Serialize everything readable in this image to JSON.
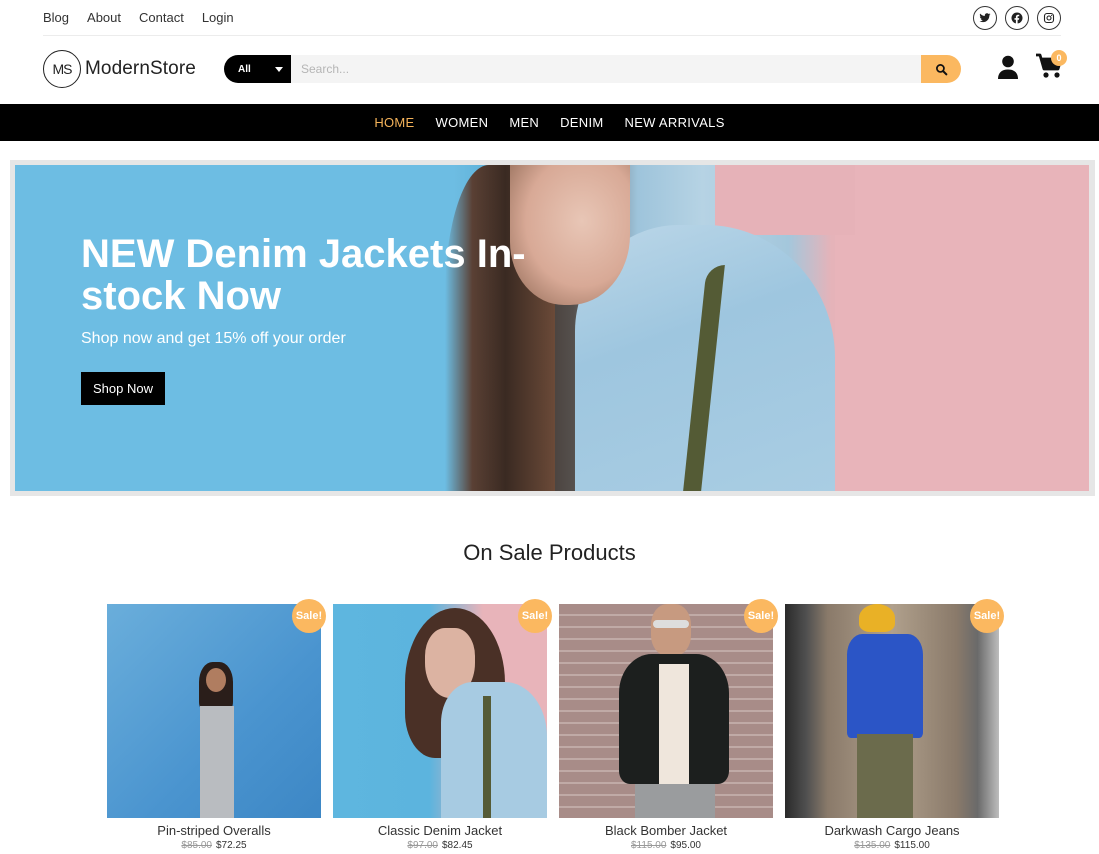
{
  "topbar": {
    "links": [
      "Blog",
      "About",
      "Contact",
      "Login"
    ],
    "socials": [
      "twitter-icon",
      "facebook-icon",
      "instagram-icon"
    ]
  },
  "header": {
    "logo_mark": "MS",
    "logo_text": "ModernStore",
    "search": {
      "category": "All",
      "placeholder": "Search...",
      "value": ""
    },
    "cart_count": "0"
  },
  "nav": {
    "items": [
      {
        "label": "HOME",
        "active": true
      },
      {
        "label": "WOMEN",
        "active": false
      },
      {
        "label": "MEN",
        "active": false
      },
      {
        "label": "DENIM",
        "active": false
      },
      {
        "label": "NEW ARRIVALS",
        "active": false
      }
    ]
  },
  "hero": {
    "title": "NEW Denim Jackets In-stock Now",
    "subtitle": "Shop now and get 15% off your order",
    "button": "Shop Now"
  },
  "sale_section": {
    "title": "On Sale Products",
    "badge": "Sale!",
    "products": [
      {
        "name": "Pin-striped Overalls",
        "old_price": "$85.00",
        "price": "$72.25"
      },
      {
        "name": "Classic Denim Jacket",
        "old_price": "$97.00",
        "price": "$82.45"
      },
      {
        "name": "Black Bomber Jacket",
        "old_price": "$115.00",
        "price": "$95.00"
      },
      {
        "name": "Darkwash Cargo Jeans",
        "old_price": "$135.00",
        "price": "$115.00"
      }
    ]
  },
  "colors": {
    "accent": "#fbb860",
    "nav_active": "#f5b35a",
    "nav_bg": "#000000"
  }
}
